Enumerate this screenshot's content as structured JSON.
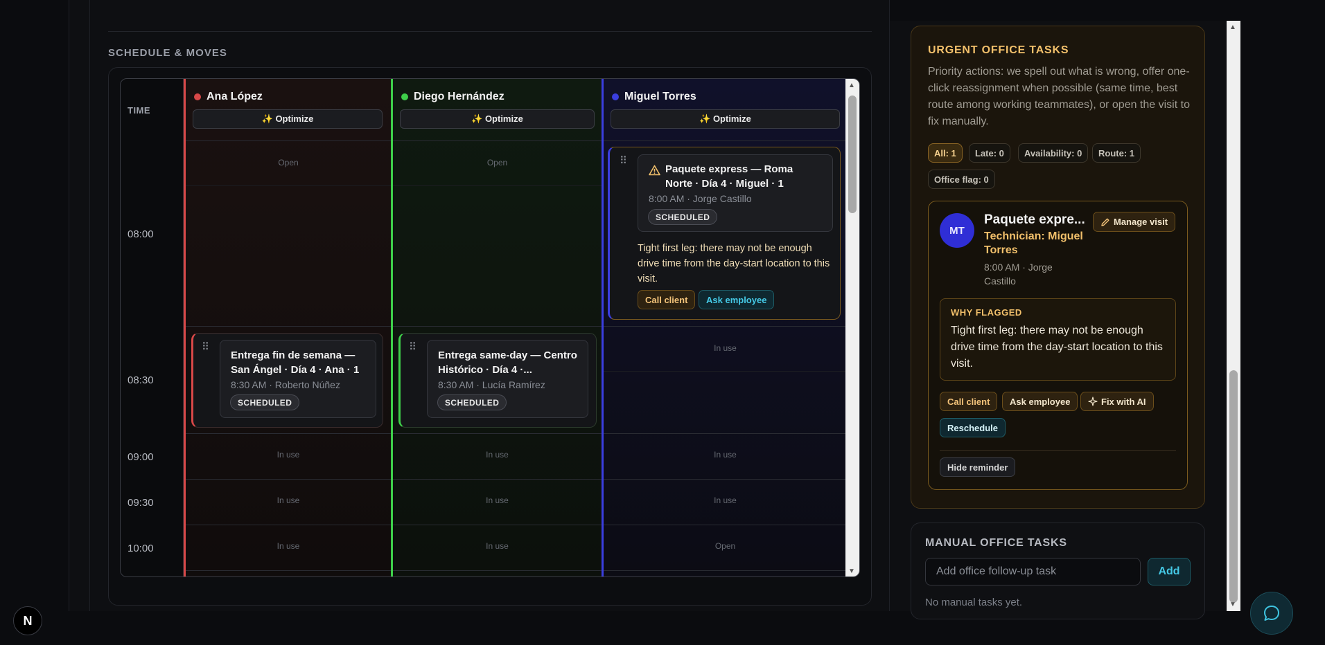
{
  "schedule": {
    "section_title": "SCHEDULE & MOVES",
    "time_header": "TIME",
    "times": [
      "08:00",
      "08:30",
      "09:00",
      "09:30",
      "10:00"
    ],
    "optimize_label": "✨ Optimize",
    "technicians": [
      {
        "name": "Ana López",
        "color": "#d84848"
      },
      {
        "name": "Diego Hernández",
        "color": "#3ecf4a"
      },
      {
        "name": "Miguel Torres",
        "color": "#3b3ee0"
      }
    ],
    "cells": {
      "open": "Open",
      "in_use": "In use"
    },
    "visits": {
      "miguel_0800": {
        "title": "Paquete express — Roma Norte · Día 4 · Miguel · 1",
        "meta": "8:00 AM · Jorge Castillo",
        "status": "SCHEDULED",
        "warning": "Tight first leg: there may not be enough drive time from the day-start location to this visit.",
        "action_call": "Call client",
        "action_ask": "Ask employee"
      },
      "ana_0830": {
        "title": "Entrega fin de semana — San Ángel · Día 4 · Ana · 1",
        "meta": "8:30 AM · Roberto Núñez",
        "status": "SCHEDULED"
      },
      "diego_0830": {
        "title": "Entrega same-day — Centro Histórico · Día 4 ·...",
        "meta": "8:30 AM · Lucía Ramírez",
        "status": "SCHEDULED"
      }
    }
  },
  "urgent": {
    "title": "URGENT OFFICE TASKS",
    "description": "Priority actions: we spell out what is wrong, offer one-click reassignment when possible (same time, best route among working teammates), or open the visit to fix manually.",
    "filters": [
      "All: 1",
      "Late: 0",
      "Availability: 0",
      "Route: 1",
      "Office flag: 0"
    ],
    "task": {
      "avatar": "MT",
      "title": "Paquete expre...",
      "technician": "Technician: Miguel Torres",
      "meta": "8:00 AM · Jorge Castillo",
      "manage_label": "Manage visit",
      "why_title": "WHY FLAGGED",
      "why_text": "Tight first leg: there may not be enough drive time from the day-start location to this visit.",
      "actions": [
        "Call client",
        "Ask employee",
        "Fix with AI",
        "Reschedule"
      ],
      "hide_label": "Hide reminder"
    }
  },
  "manual": {
    "title": "MANUAL OFFICE TASKS",
    "placeholder": "Add office follow-up task",
    "add_label": "Add",
    "empty_text": "No manual tasks yet."
  },
  "badges": {
    "next": "N"
  },
  "colors": {
    "amber": "#f2c06b",
    "cyan": "#45c9e6",
    "red": "#d84848",
    "green": "#3ecf4a",
    "blue": "#3b3ee0"
  }
}
